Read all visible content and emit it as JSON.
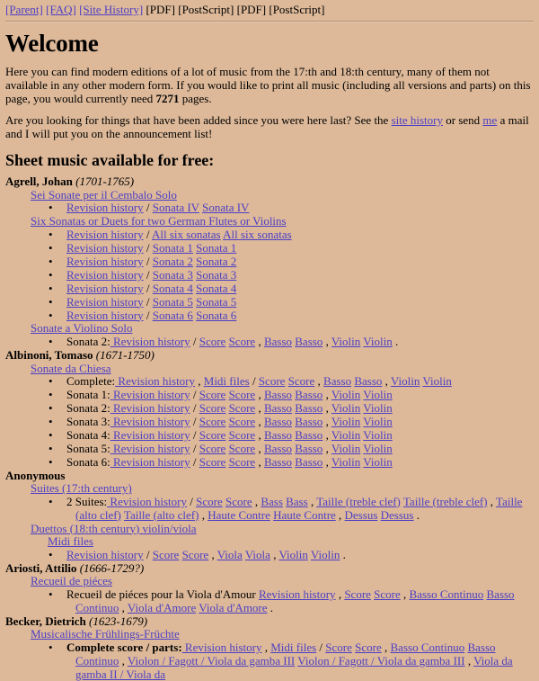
{
  "nav": {
    "links": [
      {
        "label": "[Parent]",
        "type": "link",
        "name": "nav-parent"
      },
      {
        "label": "[FAQ]",
        "type": "link",
        "name": "nav-faq"
      },
      {
        "label": "[Site History]",
        "type": "link",
        "name": "nav-site-history"
      },
      {
        "label": "[PDF]",
        "type": "plain",
        "name": "nav-pdf-1"
      },
      {
        "label": "[PostScript]",
        "type": "plain",
        "name": "nav-postscript-1"
      },
      {
        "label": "[PDF]",
        "type": "plain",
        "name": "nav-pdf-2"
      },
      {
        "label": "[PostScript]",
        "type": "plain",
        "name": "nav-postscript-2"
      }
    ]
  },
  "header": {
    "title": "Welcome"
  },
  "intro": {
    "p1_a": "Here you can find modern editions of a lot of music from the 17:th and 18:th century, many of them not available in any other modern form. If you would like to print all music (including all versions and parts) on this page, you would currently need ",
    "p1_pages": "7271",
    "p1_b": " pages.",
    "p2_a": "Are you looking for things that have been added since you were here last? See the ",
    "p2_link1": "site history",
    "p2_b": " or send ",
    "p2_link2": "me",
    "p2_c": " a mail and I will put you on the announcement list!"
  },
  "section": {
    "title": "Sheet music available for free:"
  },
  "colors": {
    "background": "#ddb999",
    "link": "#4d3fc4",
    "text": "#000000"
  },
  "composers": [
    {
      "name": "Agrell, Johan",
      "dates": "(1701-1765)",
      "works": [
        {
          "title": "Sei Sonate per il Cembalo Solo",
          "items": [
            {
              "label": "",
              "links": [
                "Revision history",
                "Sonata IV",
                "Sonata IV"
              ],
              "text": "Revision history / Sonata IV Sonata IV"
            }
          ]
        },
        {
          "title": "Six Sonatas or Duets for two German Flutes or Violins",
          "items": [
            {
              "text": "Revision history / All six sonatas All six sonatas"
            },
            {
              "text": "Revision history / Sonata 1 Sonata 1"
            },
            {
              "text": "Revision history / Sonata 2 Sonata 2"
            },
            {
              "text": "Revision history / Sonata 3 Sonata 3"
            },
            {
              "text": "Revision history / Sonata 4 Sonata 4"
            },
            {
              "text": "Revision history / Sonata 5 Sonata 5"
            },
            {
              "text": "Revision history / Sonata 6 Sonata 6"
            }
          ]
        },
        {
          "title": "Sonate a Violino Solo",
          "items": [
            {
              "text": "Sonata 2: Revision history / Score Score , Basso Basso , Violin Violin ."
            }
          ]
        }
      ]
    },
    {
      "name": "Albinoni, Tomaso",
      "dates": "(1671-1750)",
      "works": [
        {
          "title": "Sonate da Chiesa",
          "items": [
            {
              "text": "Complete: Revision history , Midi files / Score Score , Basso Basso , Violin Violin"
            },
            {
              "text": "Sonata 1: Revision history / Score Score , Basso Basso , Violin Violin"
            },
            {
              "text": "Sonata 2: Revision history / Score Score , Basso Basso , Violin Violin"
            },
            {
              "text": "Sonata 3: Revision history / Score Score , Basso Basso , Violin Violin"
            },
            {
              "text": "Sonata 4: Revision history / Score Score , Basso Basso , Violin Violin"
            },
            {
              "text": "Sonata 5: Revision history / Score Score , Basso Basso , Violin Violin"
            },
            {
              "text": "Sonata 6: Revision history / Score Score , Basso Basso , Violin Violin"
            }
          ]
        }
      ]
    },
    {
      "name": "Anonymous",
      "dates": "",
      "works": [
        {
          "title": "Suites (17:th century)",
          "items": [
            {
              "text": "2 Suites: Revision history / Score Score , Bass Bass , Taille (treble clef) Taille (treble clef) , Taille (alto clef) Taille (alto clef) , Haute Contre Haute Contre , Dessus Dessus ."
            }
          ]
        },
        {
          "title": "Duettos (18:th century) violin/viola",
          "subgroup": "Midi files",
          "items": [
            {
              "text": "Revision history / Score Score , Viola Viola , Violin Violin ."
            }
          ]
        }
      ]
    },
    {
      "name": "Ariosti, Attilio",
      "dates": "(1666-1729?)",
      "works": [
        {
          "title": "Recueil de piéces",
          "items": [
            {
              "text": "Recueil de piéces pour la Viola d'Amour Revision history , Score Score , Basso Continuo Basso Continuo , Viola d'Amore Viola d'Amore ."
            }
          ]
        }
      ]
    },
    {
      "name": "Becker, Dietrich",
      "dates": "(1623-1679)",
      "works": [
        {
          "title": "Musicalische Frühlings-Früchte",
          "items": [
            {
              "text": "Complete score / parts: Revision history , Midi files / Score Score , Basso Continuo Basso Continuo , Violon / Fagott / Viola da gamba III Violon / Fagott / Viola da gamba III , Viola da gamba II / Viola da"
            }
          ]
        }
      ]
    }
  ],
  "rows": {
    "agrell_w1_i1": [
      {
        "t": "link",
        "v": "Revision history"
      },
      {
        "t": "plain",
        "v": " / "
      },
      {
        "t": "link",
        "v": "Sonata IV"
      },
      {
        "t": "plain",
        "v": " "
      },
      {
        "t": "link",
        "v": "Sonata IV"
      }
    ]
  }
}
